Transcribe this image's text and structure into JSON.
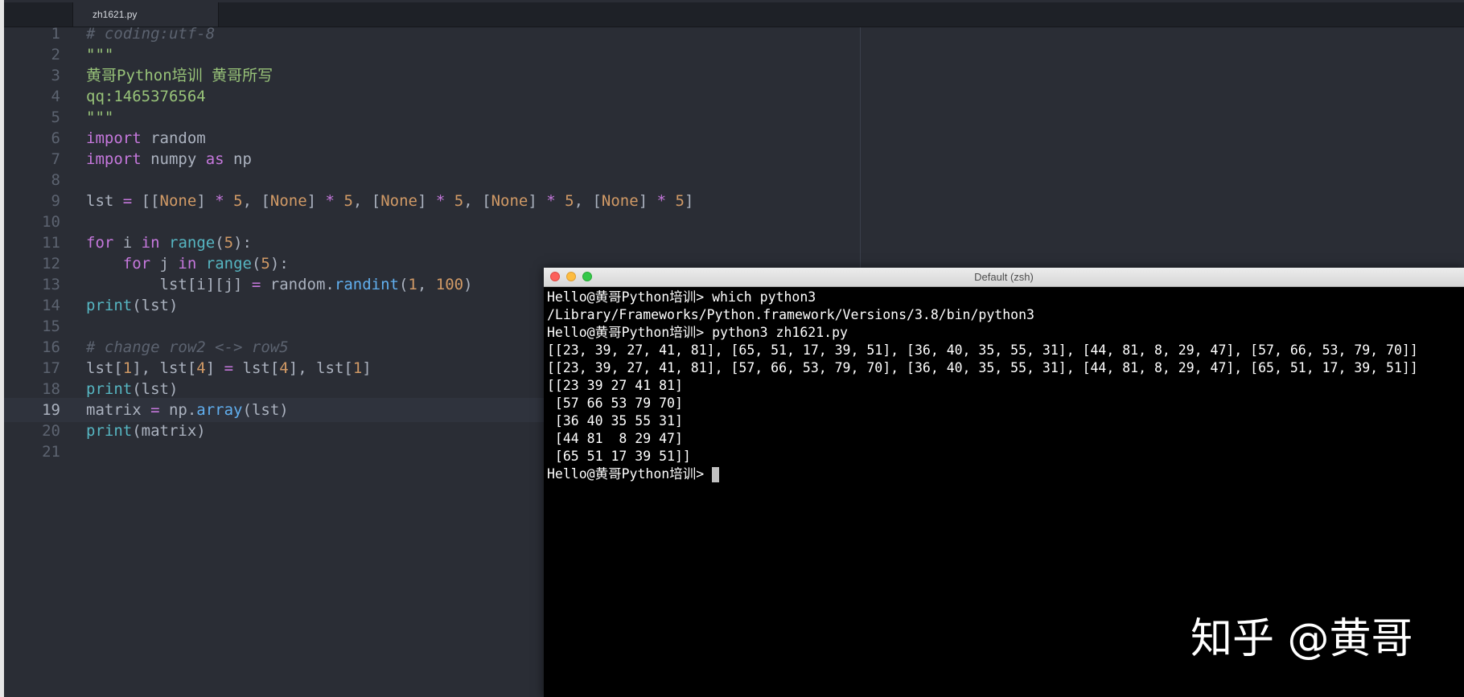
{
  "editor": {
    "tab_title": "zh1621.py",
    "active_line": 19,
    "lines": [
      {
        "n": "1",
        "tokens": [
          {
            "t": "# coding:utf-8",
            "c": "c"
          }
        ]
      },
      {
        "n": "2",
        "tokens": [
          {
            "t": "\"\"\"",
            "c": "s"
          }
        ]
      },
      {
        "n": "3",
        "tokens": [
          {
            "t": "黄哥Python培训 黄哥所写",
            "c": "s"
          }
        ]
      },
      {
        "n": "4",
        "tokens": [
          {
            "t": "qq:1465376564",
            "c": "s"
          }
        ]
      },
      {
        "n": "5",
        "tokens": [
          {
            "t": "\"\"\"",
            "c": "s"
          }
        ]
      },
      {
        "n": "6",
        "tokens": [
          {
            "t": "import",
            "c": "k"
          },
          {
            "t": " random",
            "c": "t"
          }
        ]
      },
      {
        "n": "7",
        "tokens": [
          {
            "t": "import",
            "c": "k"
          },
          {
            "t": " numpy ",
            "c": "t"
          },
          {
            "t": "as",
            "c": "k"
          },
          {
            "t": " np",
            "c": "t"
          }
        ]
      },
      {
        "n": "8",
        "tokens": []
      },
      {
        "n": "9",
        "tokens": [
          {
            "t": "lst ",
            "c": "t"
          },
          {
            "t": "=",
            "c": "o"
          },
          {
            "t": " [[",
            "c": "t"
          },
          {
            "t": "None",
            "c": "n"
          },
          {
            "t": "] ",
            "c": "t"
          },
          {
            "t": "*",
            "c": "o"
          },
          {
            "t": " ",
            "c": "t"
          },
          {
            "t": "5",
            "c": "n"
          },
          {
            "t": ", [",
            "c": "t"
          },
          {
            "t": "None",
            "c": "n"
          },
          {
            "t": "] ",
            "c": "t"
          },
          {
            "t": "*",
            "c": "o"
          },
          {
            "t": " ",
            "c": "t"
          },
          {
            "t": "5",
            "c": "n"
          },
          {
            "t": ", [",
            "c": "t"
          },
          {
            "t": "None",
            "c": "n"
          },
          {
            "t": "] ",
            "c": "t"
          },
          {
            "t": "*",
            "c": "o"
          },
          {
            "t": " ",
            "c": "t"
          },
          {
            "t": "5",
            "c": "n"
          },
          {
            "t": ", [",
            "c": "t"
          },
          {
            "t": "None",
            "c": "n"
          },
          {
            "t": "] ",
            "c": "t"
          },
          {
            "t": "*",
            "c": "o"
          },
          {
            "t": " ",
            "c": "t"
          },
          {
            "t": "5",
            "c": "n"
          },
          {
            "t": ", [",
            "c": "t"
          },
          {
            "t": "None",
            "c": "n"
          },
          {
            "t": "] ",
            "c": "t"
          },
          {
            "t": "*",
            "c": "o"
          },
          {
            "t": " ",
            "c": "t"
          },
          {
            "t": "5",
            "c": "n"
          },
          {
            "t": "]",
            "c": "t"
          }
        ]
      },
      {
        "n": "10",
        "tokens": []
      },
      {
        "n": "11",
        "tokens": [
          {
            "t": "for",
            "c": "k"
          },
          {
            "t": " i ",
            "c": "t"
          },
          {
            "t": "in",
            "c": "k"
          },
          {
            "t": " ",
            "c": "t"
          },
          {
            "t": "range",
            "c": "b"
          },
          {
            "t": "(",
            "c": "t"
          },
          {
            "t": "5",
            "c": "n"
          },
          {
            "t": "):",
            "c": "t"
          }
        ]
      },
      {
        "n": "12",
        "tokens": [
          {
            "t": "    ",
            "c": "t"
          },
          {
            "t": "for",
            "c": "k"
          },
          {
            "t": " j ",
            "c": "t"
          },
          {
            "t": "in",
            "c": "k"
          },
          {
            "t": " ",
            "c": "t"
          },
          {
            "t": "range",
            "c": "b"
          },
          {
            "t": "(",
            "c": "t"
          },
          {
            "t": "5",
            "c": "n"
          },
          {
            "t": "):",
            "c": "t"
          }
        ]
      },
      {
        "n": "13",
        "tokens": [
          {
            "t": "        lst[i][j] ",
            "c": "t"
          },
          {
            "t": "=",
            "c": "o"
          },
          {
            "t": " random.",
            "c": "t"
          },
          {
            "t": "randint",
            "c": "f"
          },
          {
            "t": "(",
            "c": "t"
          },
          {
            "t": "1",
            "c": "n"
          },
          {
            "t": ", ",
            "c": "t"
          },
          {
            "t": "100",
            "c": "n"
          },
          {
            "t": ")",
            "c": "t"
          }
        ]
      },
      {
        "n": "14",
        "tokens": [
          {
            "t": "print",
            "c": "b"
          },
          {
            "t": "(lst)",
            "c": "t"
          }
        ]
      },
      {
        "n": "15",
        "tokens": []
      },
      {
        "n": "16",
        "tokens": [
          {
            "t": "# change row2 <-> row5",
            "c": "c"
          }
        ]
      },
      {
        "n": "17",
        "tokens": [
          {
            "t": "lst[",
            "c": "t"
          },
          {
            "t": "1",
            "c": "n"
          },
          {
            "t": "], lst[",
            "c": "t"
          },
          {
            "t": "4",
            "c": "n"
          },
          {
            "t": "] ",
            "c": "t"
          },
          {
            "t": "=",
            "c": "o"
          },
          {
            "t": " lst[",
            "c": "t"
          },
          {
            "t": "4",
            "c": "n"
          },
          {
            "t": "], lst[",
            "c": "t"
          },
          {
            "t": "1",
            "c": "n"
          },
          {
            "t": "]",
            "c": "t"
          }
        ]
      },
      {
        "n": "18",
        "tokens": [
          {
            "t": "print",
            "c": "b"
          },
          {
            "t": "(lst)",
            "c": "t"
          }
        ]
      },
      {
        "n": "19",
        "tokens": [
          {
            "t": "matrix ",
            "c": "t"
          },
          {
            "t": "=",
            "c": "o"
          },
          {
            "t": " np.",
            "c": "t"
          },
          {
            "t": "array",
            "c": "f"
          },
          {
            "t": "(lst)",
            "c": "t"
          }
        ]
      },
      {
        "n": "20",
        "tokens": [
          {
            "t": "print",
            "c": "b"
          },
          {
            "t": "(matrix)",
            "c": "t"
          }
        ]
      },
      {
        "n": "21",
        "tokens": []
      }
    ]
  },
  "terminal": {
    "title": "Default (zsh)",
    "lines": [
      "Hello@黄哥Python培训> which python3",
      "/Library/Frameworks/Python.framework/Versions/3.8/bin/python3",
      "Hello@黄哥Python培训> python3 zh1621.py",
      "[[23, 39, 27, 41, 81], [65, 51, 17, 39, 51], [36, 40, 35, 55, 31], [44, 81, 8, 29, 47], [57, 66, 53, 79, 70]]",
      "[[23, 39, 27, 41, 81], [57, 66, 53, 79, 70], [36, 40, 35, 55, 31], [44, 81, 8, 29, 47], [65, 51, 17, 39, 51]]",
      "[[23 39 27 41 81]",
      " [57 66 53 79 70]",
      " [36 40 35 55 31]",
      " [44 81  8 29 47]",
      " [65 51 17 39 51]]"
    ],
    "prompt": "Hello@黄哥Python培训> "
  },
  "watermark": "知乎 @黄哥"
}
